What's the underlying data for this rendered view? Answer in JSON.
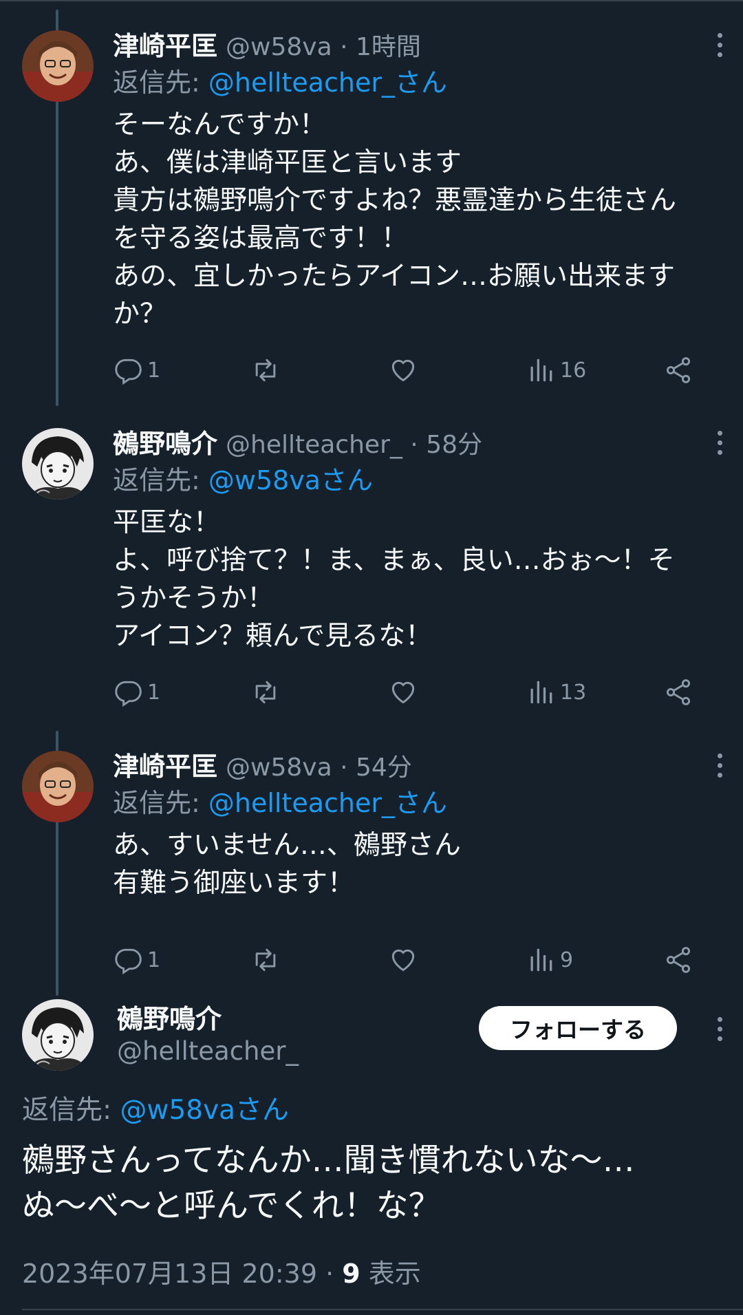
{
  "colors": {
    "background": "#15202b",
    "text_primary": "#f7f9f9",
    "text_secondary": "#8b98a5",
    "link": "#1d9bf0",
    "thread_line": "#3d5466"
  },
  "tweets": [
    {
      "name": "津崎平匡",
      "meta": "@w58va · 1時間",
      "reply_prefix": "返信先: ",
      "reply_handle": "@hellteacher_さん",
      "text": "そーなんですか！\nあ、僕は津崎平匡と言います\n貴方は鵺野鳴介ですよね？悪霊達から生徒さん\nを守る姿は最高です！！\nあの、宜しかったらアイコン…お願い出来ます\nか？",
      "replies": "1",
      "views": "16",
      "avatar_icon": "avatar-smiling-man"
    },
    {
      "name": "鵺野鳴介",
      "meta": "@hellteacher_ · 58分",
      "reply_prefix": "返信先: ",
      "reply_handle": "@w58vaさん",
      "text": "平匡な！\nよ、呼び捨て？！ま、まぁ、良い…おぉ～！そ\nうかそうか！\nアイコン？頼んで見るな！",
      "replies": "1",
      "views": "13",
      "avatar_icon": "avatar-anime-character"
    },
    {
      "name": "津崎平匡",
      "meta": "@w58va · 54分",
      "reply_prefix": "返信先: ",
      "reply_handle": "@hellteacher_さん",
      "text": "あ、すいません…、鵺野さん\n有難う御座います！",
      "replies": "1",
      "views": "9",
      "avatar_icon": "avatar-smiling-man"
    }
  ],
  "main": {
    "name": "鵺野鳴介",
    "handle": "@hellteacher_",
    "follow_label": "フォローする",
    "reply_prefix": "返信先: ",
    "reply_handle": "@w58vaさん",
    "text": "鵺野さんってなんか…聞き慣れないな～…\nぬ～べ～と呼んでくれ！な？",
    "timestamp": "2023年07月13日 20:39 · ",
    "views_count": "9",
    "views_label": " 表示",
    "avatar_icon": "avatar-anime-character"
  },
  "icons": {
    "reply": "reply-icon",
    "retweet": "retweet-icon",
    "like": "heart-icon",
    "views": "views-icon",
    "share": "share-icon",
    "more": "more-icon"
  }
}
